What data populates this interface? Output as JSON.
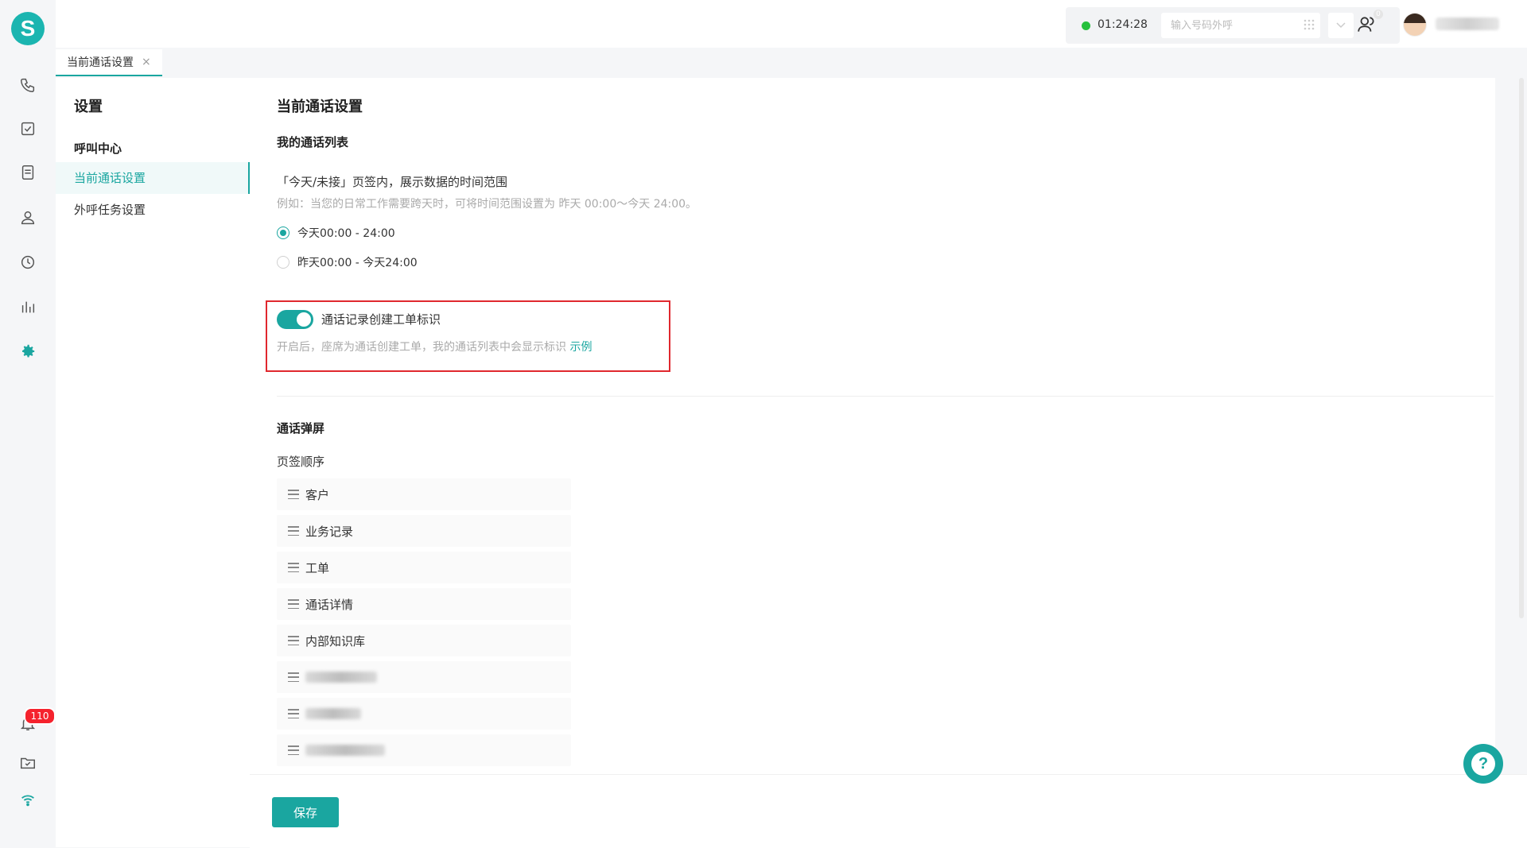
{
  "app": {
    "logo_letter": "S",
    "brand_color": "#1aa6a0"
  },
  "rail": {
    "icons": [
      "phone-icon",
      "task-check-icon",
      "document-icon",
      "contacts-icon",
      "history-clock-icon",
      "bar-chart-icon",
      "settings-gear-icon"
    ],
    "bottom_icons": [
      "bell-icon",
      "folder-icon",
      "wifi-icon"
    ],
    "notification_count": "110"
  },
  "topbar": {
    "call_timer": "01:24:28",
    "dial_placeholder": "输入号码外呼",
    "contacts_badge": "0",
    "status_color": "#26c03d"
  },
  "tabs": [
    {
      "label": "当前通话设置",
      "close": "×"
    }
  ],
  "settings_nav": {
    "title": "设置",
    "group": "呼叫中心",
    "items": [
      {
        "label": "当前通话设置",
        "active": true
      },
      {
        "label": "外呼任务设置",
        "active": false
      }
    ]
  },
  "main": {
    "page_title": "当前通话设置",
    "my_calls": {
      "section_title": "我的通话列表",
      "range_label": "「今天/未接」页签内，展示数据的时间范围",
      "range_hint": "例如：当您的日常工作需要跨天时，可将时间范围设置为 昨天 00:00～今天 24:00。",
      "options": [
        {
          "label": "今天00:00 - 24:00",
          "checked": true
        },
        {
          "label": "昨天00:00 - 今天24:00",
          "checked": false
        }
      ],
      "toggle": {
        "label": "通话记录创建工单标识",
        "enabled": true,
        "desc": "开启后，座席为通话创建工单，我的通话列表中会显示标识",
        "link": "示例"
      }
    },
    "popup": {
      "section_title": "通话弹屏",
      "order_label": "页签顺序",
      "items": [
        "客户",
        "业务记录",
        "工单",
        "通话详情",
        "内部知识库"
      ]
    }
  },
  "footer": {
    "save_label": "保存",
    "help_label": "?"
  }
}
